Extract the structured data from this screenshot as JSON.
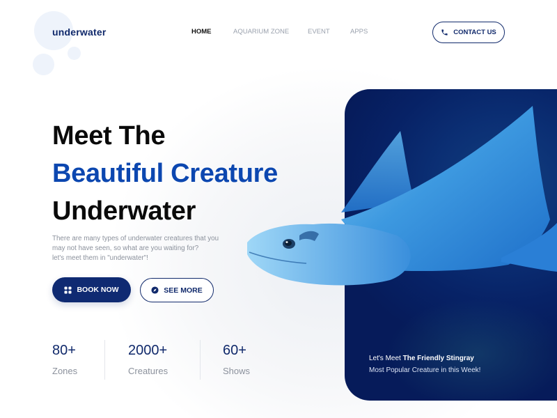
{
  "brand": {
    "name": "underwater",
    "color": "#10296b"
  },
  "nav": {
    "items": [
      {
        "label": "HOME",
        "active": true
      },
      {
        "label": "AQUARIUM ZONE",
        "active": false
      },
      {
        "label": "EVENT",
        "active": false
      },
      {
        "label": "APPS",
        "active": false
      }
    ]
  },
  "header": {
    "contact_label": "CONTACT US",
    "contact_icon": "phone-icon"
  },
  "hero": {
    "title_line1": "Meet The",
    "title_line2": "Beautiful Creature",
    "title_line3": "Underwater",
    "accent_color": "#0c47b0",
    "description_line1": "There are many types of underwater creatures that you",
    "description_line2": "may not have seen, so what are you waiting for?",
    "description_line3": "let's meet them in \"underwater\"!"
  },
  "actions": {
    "book_label": "BOOK NOW",
    "book_icon": "grid-icon",
    "see_more_label": "SEE MORE",
    "see_more_icon": "compass-icon"
  },
  "stats": [
    {
      "value": "80+",
      "label": "Zones"
    },
    {
      "value": "2000+",
      "label": "Creatures"
    },
    {
      "value": "60+",
      "label": "Shows"
    }
  ],
  "feature": {
    "caption_prefix": "Let's Meet",
    "caption_name": "The Friendly Stingray",
    "caption_sub": "Most Popular Creature in this Week!",
    "card_color": "#072266"
  }
}
